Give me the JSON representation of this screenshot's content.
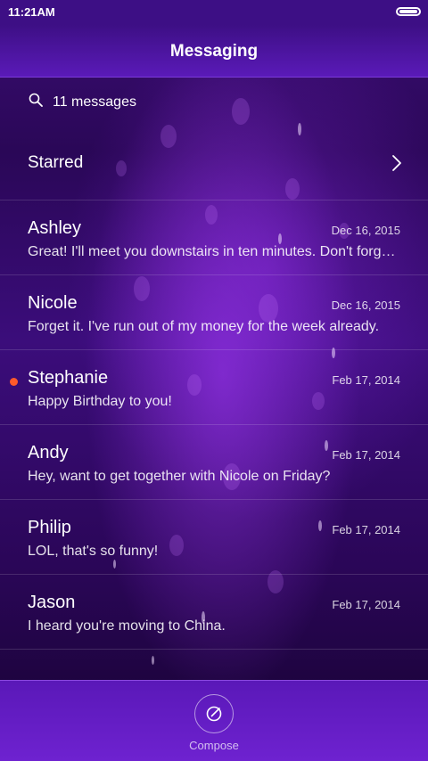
{
  "status_bar": {
    "time": "11:21AM"
  },
  "header": {
    "title": "Messaging"
  },
  "search": {
    "text": "11 messages"
  },
  "starred": {
    "label": "Starred"
  },
  "conversations": [
    {
      "name": "Ashley",
      "date": "Dec 16, 2015",
      "preview": "Great! I'll meet you downstairs in ten minutes. Don't forget the tickets!",
      "unread": false
    },
    {
      "name": "Nicole",
      "date": "Dec 16, 2015",
      "preview": "Forget it. I've run out of my money for the week already.",
      "unread": false
    },
    {
      "name": "Stephanie",
      "date": "Feb 17, 2014",
      "preview": "Happy Birthday to you!",
      "unread": true
    },
    {
      "name": "Andy",
      "date": "Feb 17, 2014",
      "preview": "Hey, want to get together with Nicole on Friday?",
      "unread": false
    },
    {
      "name": "Philip",
      "date": "Feb 17, 2014",
      "preview": "LOL, that's so funny!",
      "unread": false
    },
    {
      "name": "Jason",
      "date": "Feb 17, 2014",
      "preview": "I heard you're moving to China.",
      "unread": false
    }
  ],
  "bottom_bar": {
    "compose_label": "Compose"
  },
  "colors": {
    "header": "#3d0f85",
    "bottom_bar": "#6e22d0",
    "unread_dot": "#ff5a2a"
  }
}
